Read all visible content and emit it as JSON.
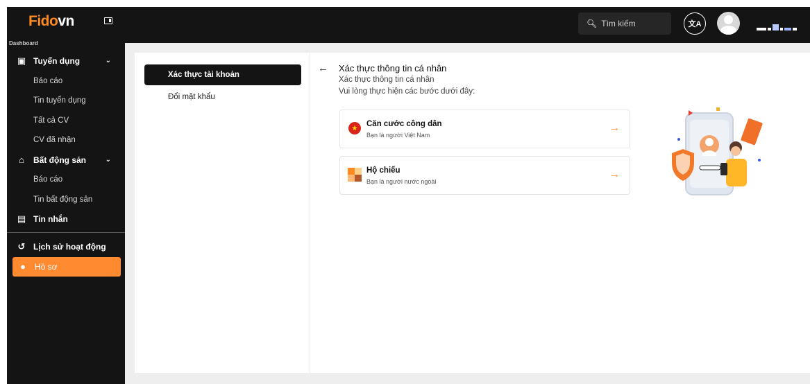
{
  "sidebar": {
    "logo_part1": "Fido",
    "logo_part2": "vn",
    "section_label": "Dashboard",
    "groups": [
      {
        "label": "Tuyển dụng",
        "icon": "recruitment-icon",
        "children": [
          "Báo cáo",
          "Tin tuyển dụng",
          "Tất cả CV",
          "CV đã nhận"
        ]
      },
      {
        "label": "Bất động sản",
        "icon": "real-estate-icon",
        "children": [
          "Báo cáo",
          "Tin bất động sản"
        ]
      },
      {
        "label": "Tin nhắn",
        "icon": "message-icon"
      }
    ],
    "bottom": [
      {
        "label": "Lịch sử hoạt động",
        "icon": "history-icon"
      },
      {
        "label": "Hồ sơ",
        "icon": "profile-icon",
        "active": true
      }
    ]
  },
  "topbar": {
    "search_placeholder": "Tìm kiếm",
    "translate_icon": "translate-icon"
  },
  "subnav": {
    "active": "Xác thực tài khoản",
    "items": [
      "Đổi mật khẩu"
    ]
  },
  "verify": {
    "title": "Xác thực thông tin cá nhân",
    "subtitle": "Xác thực thông tin cá nhân",
    "note": "Vui lòng thực hiện các bước dưới đây:",
    "options": [
      {
        "title": "Căn cước công dân",
        "desc": "Bạn là người Việt Nam",
        "icon": "vietnam-flag-icon"
      },
      {
        "title": "Hộ chiếu",
        "desc": "Bạn là người nước ngoài",
        "icon": "passport-icon"
      }
    ]
  },
  "colors": {
    "accent": "#ff8a1f",
    "sidebar_bg": "#141414",
    "content_bg": "#eeeeee"
  }
}
